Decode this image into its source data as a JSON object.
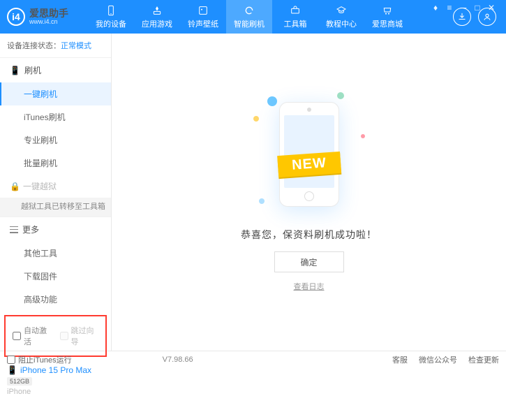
{
  "app": {
    "name": "爱思助手",
    "url": "www.i4.cn"
  },
  "nav": [
    {
      "label": "我的设备"
    },
    {
      "label": "应用游戏"
    },
    {
      "label": "铃声壁纸"
    },
    {
      "label": "智能刷机"
    },
    {
      "label": "工具箱"
    },
    {
      "label": "教程中心"
    },
    {
      "label": "爱思商城"
    }
  ],
  "status": {
    "label": "设备连接状态：",
    "value": "正常模式"
  },
  "sidebar": {
    "flash": {
      "title": "刷机",
      "items": [
        "一键刷机",
        "iTunes刷机",
        "专业刷机",
        "批量刷机"
      ]
    },
    "jailbreak": {
      "label": "一键越狱",
      "note": "越狱工具已转移至工具箱"
    },
    "more": {
      "title": "更多",
      "items": [
        "其他工具",
        "下载固件",
        "高级功能"
      ]
    }
  },
  "checkboxes": {
    "autoActivate": "自动激活",
    "skipGuide": "跳过向导"
  },
  "device": {
    "name": "iPhone 15 Pro Max",
    "storage": "512GB",
    "type": "iPhone"
  },
  "main": {
    "newTag": "NEW",
    "message": "恭喜您，保资料刷机成功啦！",
    "okButton": "确定",
    "logLink": "查看日志"
  },
  "footer": {
    "blockItunes": "阻止iTunes运行",
    "version": "V7.98.66",
    "links": [
      "客服",
      "微信公众号",
      "检查更新"
    ]
  }
}
